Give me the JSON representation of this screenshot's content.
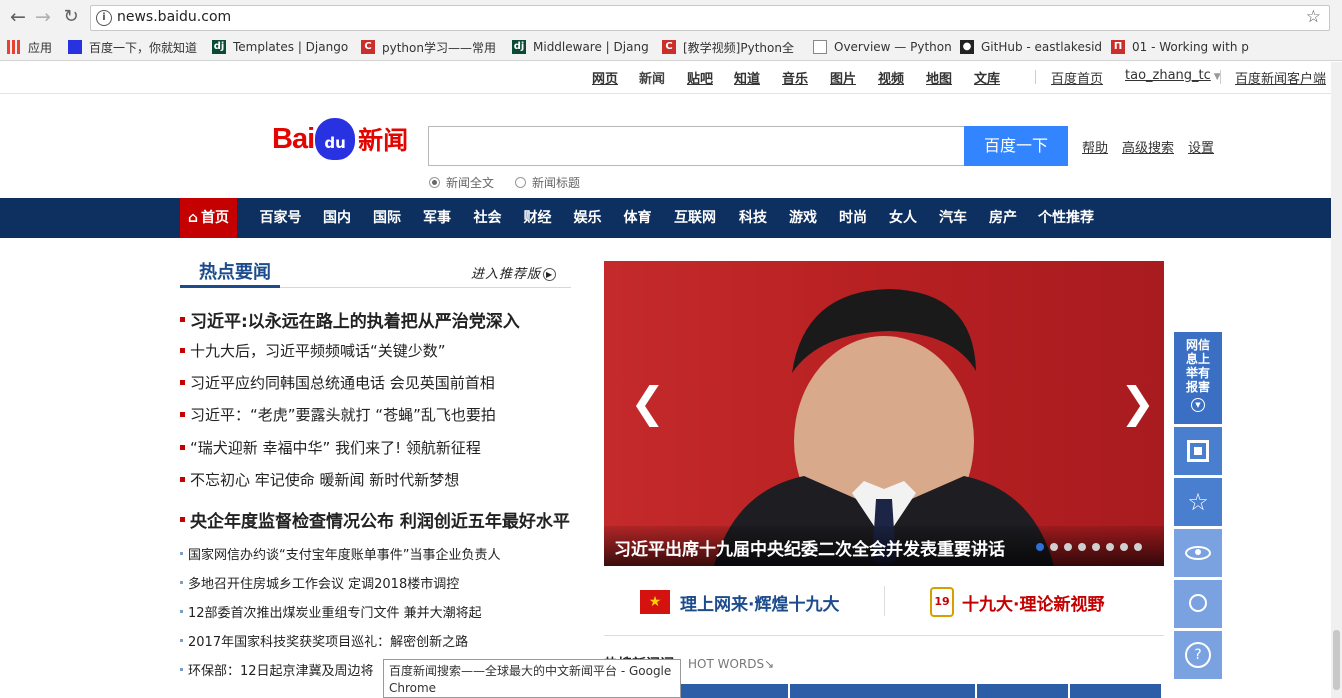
{
  "browser": {
    "url": "news.baidu.com"
  },
  "bookmarks": [
    {
      "label": "应用",
      "icon": "apps-grid-icon",
      "color": "#e94235"
    },
    {
      "label": "百度一下，你就知道",
      "icon": "baidu-paw-icon",
      "color": "#2932e1"
    },
    {
      "label": "Templates | Django",
      "icon": "django-icon",
      "color": "#0c4b33"
    },
    {
      "label": "python学习——常用",
      "icon": "csdn-icon",
      "color": "#c9302c"
    },
    {
      "label": "Middleware | Djang",
      "icon": "django-icon",
      "color": "#0c4b33"
    },
    {
      "label": "[教学视频]Python全",
      "icon": "csdn-icon",
      "color": "#c9302c"
    },
    {
      "label": "Overview — Python",
      "icon": "page-icon",
      "color": "#888888"
    },
    {
      "label": "GitHub - eastlakesid",
      "icon": "github-icon",
      "color": "#222222"
    },
    {
      "label": "01 - Working with p",
      "icon": "docs-icon",
      "color": "#c9302c"
    }
  ],
  "toplinks": [
    "网页",
    "新闻",
    "贴吧",
    "知道",
    "音乐",
    "图片",
    "视频",
    "地图",
    "文库"
  ],
  "topright": {
    "home": "百度首页",
    "user": "tao_zhang_tc",
    "client": "百度新闻客户端"
  },
  "logo": {
    "bai": "Bai",
    "du": "du",
    "news": "新闻"
  },
  "search": {
    "button": "百度一下",
    "help": "帮助",
    "advanced": "高级搜索",
    "settings": "设置",
    "opt1": "新闻全文",
    "opt2": "新闻标题"
  },
  "nav": [
    "首页",
    "百家号",
    "国内",
    "国际",
    "军事",
    "社会",
    "财经",
    "娱乐",
    "体育",
    "互联网",
    "科技",
    "游戏",
    "时尚",
    "女人",
    "汽车",
    "房产",
    "个性推荐"
  ],
  "hot": {
    "title": "热点要闻",
    "more": "进入推荐版"
  },
  "news": [
    {
      "text": "习近平:以永远在路上的执着把从严治党深入",
      "size": "big"
    },
    {
      "text": "十九大后，习近平频频喊话“关键少数”",
      "size": "mid"
    },
    {
      "text": "习近平应约同韩国总统通电话 会见英国前首相",
      "size": "mid"
    },
    {
      "text": "习近平：“老虎”要露头就打 “苍蝇”乱飞也要拍",
      "size": "mid"
    },
    {
      "text": "“瑞犬迎新 幸福中华” 我们来了! 领航新征程",
      "size": "mid"
    },
    {
      "text": "不忘初心 牢记使命 暖新闻 新时代新梦想",
      "size": "mid"
    },
    {
      "text": "央企年度监督检查情况公布 利润创近五年最好水平",
      "size": "big"
    },
    {
      "text": "国家网信办约谈“支付宝年度账单事件”当事企业负责人",
      "size": "small"
    },
    {
      "text": "多地召开住房城乡工作会议 定调2018楼市调控",
      "size": "small"
    },
    {
      "text": "12部委首次推出煤炭业重组专门文件 兼并大潮将起",
      "size": "small"
    },
    {
      "text": "2017年国家科技奖获奖项目巡礼：解密创新之路",
      "size": "small"
    },
    {
      "text": "环保部：12日起京津冀及周边将",
      "size": "small"
    }
  ],
  "carousel": {
    "caption": "习近平出席十九届中央纪委二次全会并发表重要讲话",
    "dots": 8,
    "active": 0
  },
  "banners": {
    "left": "理上网来·辉煌十九大",
    "right": "十九大·理论新视野"
  },
  "hotwords": {
    "cn": "热搜新闻词",
    "en": "HOT WORDS↘"
  },
  "float": {
    "report": "网信息上举有报害"
  },
  "tooltip": {
    "line1": "百度新闻搜索——全球最大的中文新闻平台 - Google",
    "line2": "Chrome"
  }
}
